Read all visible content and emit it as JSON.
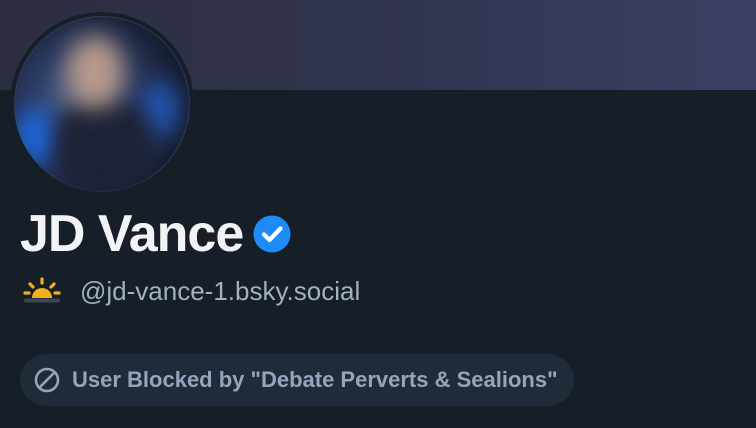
{
  "profile": {
    "display_name": "JD Vance",
    "handle": "@jd-vance-1.bsky.social",
    "verified_icon": "verified-check-icon",
    "status_emoji": "sunrise-icon"
  },
  "moderation": {
    "blocked_label": "User Blocked by \"Debate Perverts & Sealions\"",
    "icon": "block-icon"
  },
  "colors": {
    "background": "#161e27",
    "banner": "#323551",
    "verified": "#1d8cf8",
    "handle_text": "#a2b0c0",
    "pill_background": "#1f2b39"
  }
}
